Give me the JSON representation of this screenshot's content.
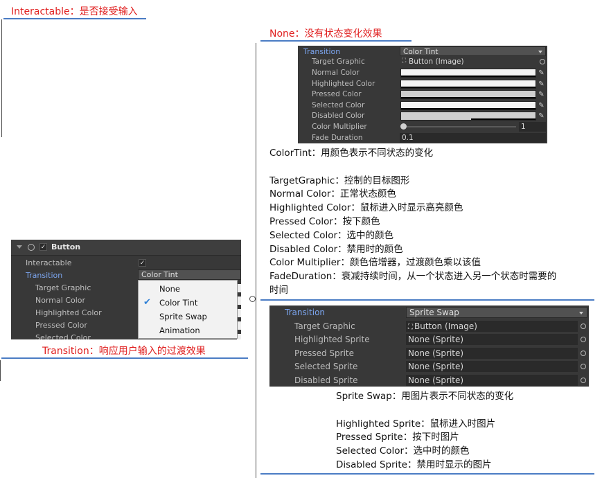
{
  "notes": {
    "interactable_title": "Interactable：是否接受输入",
    "none_title": "None：没有状态变化效果",
    "transition_title": "Transition：响应用户输入的过渡效果",
    "colortint_lines": [
      "ColorTint：用颜色表示不同状态的变化",
      "",
      "TargetGraphic：控制的目标图形",
      "Normal Color：正常状态颜色",
      "Highlighted Color：鼠标进入时显示高亮颜色",
      "Pressed Color：按下颜色",
      "Selected Color：选中的颜色",
      "Disabled Color：禁用时的颜色",
      "Color Multiplier：颜色倍增器，过渡颜色乘以该值",
      "FadeDuration：衰减持续时间，从一个状态进入另一个状态时需要的",
      "时间"
    ],
    "spriteswap_lines": [
      "Sprite Swap：用图片表示不同状态的变化",
      "",
      "Highlighted Sprite：鼠标进入时图片",
      "Pressed Sprite：按下时图片",
      "Selected Color：选中时的颜色",
      "Disabled Sprite：禁用时显示的图片"
    ]
  },
  "button_inspector": {
    "component_name": "Button",
    "interactable_label": "Interactable",
    "transition_label": "Transition",
    "transition_value": "Color Tint",
    "rows": [
      "Target Graphic",
      "Normal Color",
      "Highlighted Color",
      "Pressed Color",
      "Selected Color"
    ],
    "menu_items": [
      "None",
      "Color Tint",
      "Sprite Swap",
      "Animation"
    ],
    "menu_selected": "Color Tint"
  },
  "colortint_panel": {
    "transition_label": "Transition",
    "transition_value": "Color Tint",
    "target_graphic_label": "Target Graphic",
    "target_graphic_value": "Button (Image)",
    "color_rows": [
      "Normal Color",
      "Highlighted Color",
      "Pressed Color",
      "Selected Color",
      "Disabled Color"
    ],
    "color_multiplier_label": "Color Multiplier",
    "color_multiplier_value": "1",
    "color_multiplier_slider": 0.0,
    "fade_duration_label": "Fade Duration",
    "fade_duration_value": "0.1"
  },
  "spriteswap_panel": {
    "transition_label": "Transition",
    "transition_value": "Sprite Swap",
    "rows": [
      {
        "label": "Target Graphic",
        "value": "Button (Image)"
      },
      {
        "label": "Highlighted Sprite",
        "value": "None (Sprite)"
      },
      {
        "label": "Pressed Sprite",
        "value": "None (Sprite)"
      },
      {
        "label": "Selected Sprite",
        "value": "None (Sprite)"
      },
      {
        "label": "Disabled Sprite",
        "value": "None (Sprite)"
      }
    ]
  },
  "colors": {
    "title_red": "#e02020",
    "underline_blue": "#4a7cc4",
    "unity_panel": "#383838",
    "unity_selected_label": "#7ca6f0"
  }
}
